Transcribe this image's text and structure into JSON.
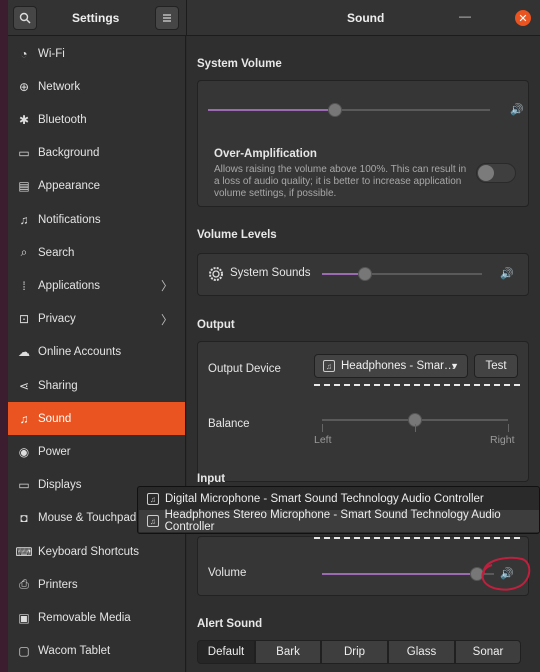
{
  "header": {
    "sidebar_title": "Settings",
    "main_title": "Sound",
    "search_icon": "search-icon",
    "menu_icon": "hamburger-menu-icon",
    "minimize_glyph": "—",
    "close_glyph": "✕"
  },
  "sidebar": {
    "items": [
      {
        "label": "Wi-Fi",
        "icon": "wifi-icon",
        "glyph": "◔"
      },
      {
        "label": "Network",
        "icon": "network-icon",
        "glyph": "⊕"
      },
      {
        "label": "Bluetooth",
        "icon": "bluetooth-icon",
        "glyph": "✱"
      },
      {
        "label": "Background",
        "icon": "background-icon",
        "glyph": "▭"
      },
      {
        "label": "Appearance",
        "icon": "appearance-icon",
        "glyph": "▤"
      },
      {
        "label": "Notifications",
        "icon": "bell-icon",
        "glyph": "♫"
      },
      {
        "label": "Search",
        "icon": "search-icon",
        "glyph": "⌕"
      },
      {
        "label": "Applications",
        "icon": "applications-icon",
        "glyph": "⁞"
      },
      {
        "label": "Privacy",
        "icon": "privacy-icon",
        "glyph": "⊡"
      },
      {
        "label": "Online Accounts",
        "icon": "cloud-icon",
        "glyph": "☁"
      },
      {
        "label": "Sharing",
        "icon": "share-icon",
        "glyph": "⋖"
      },
      {
        "label": "Sound",
        "icon": "music-note-icon",
        "glyph": "♫"
      },
      {
        "label": "Power",
        "icon": "power-icon",
        "glyph": "◉"
      },
      {
        "label": "Displays",
        "icon": "display-icon",
        "glyph": "▭"
      },
      {
        "label": "Mouse & Touchpad",
        "icon": "mouse-icon",
        "glyph": "◘"
      },
      {
        "label": "Keyboard Shortcuts",
        "icon": "keyboard-icon",
        "glyph": "⌨"
      },
      {
        "label": "Printers",
        "icon": "printer-icon",
        "glyph": "⎙"
      },
      {
        "label": "Removable Media",
        "icon": "removable-media-icon",
        "glyph": "▣"
      },
      {
        "label": "Wacom Tablet",
        "icon": "tablet-icon",
        "glyph": "▢"
      }
    ],
    "chevron_glyph": "〉",
    "active_label": "Sound"
  },
  "system_volume": {
    "title": "System Volume",
    "level": 0.45,
    "over_amp_title": "Over-Amplification",
    "over_amp_desc": "Allows raising the volume above 100%. This can result in a loss of audio quality; it is better to increase application volume settings, if possible.",
    "over_amp_enabled": false
  },
  "volume_levels": {
    "title": "Volume Levels",
    "system_sounds_label": "System Sounds",
    "system_sounds_level": 0.27
  },
  "output": {
    "title": "Output",
    "device_label": "Output Device",
    "device_value": "Headphones - Smar…",
    "test_label": "Test",
    "balance_label": "Balance",
    "balance_left": "Left",
    "balance_right": "Right",
    "balance_level": 0.5
  },
  "input": {
    "title": "Input",
    "volume_label": "Volume",
    "volume_level": 0.9,
    "options": [
      "Digital Microphone - Smart Sound Technology Audio Controller",
      "Headphones Stereo Microphone - Smart Sound Technology Audio Controller"
    ]
  },
  "alert_sound": {
    "title": "Alert Sound",
    "options": [
      "Default",
      "Bark",
      "Drip",
      "Glass",
      "Sonar"
    ],
    "selected": "Default"
  },
  "colors": {
    "accent": "#e95420",
    "slider_fill": "#9a6bb3",
    "annotation_circle": "#c0203e"
  },
  "speaker_glyph": "🔊"
}
